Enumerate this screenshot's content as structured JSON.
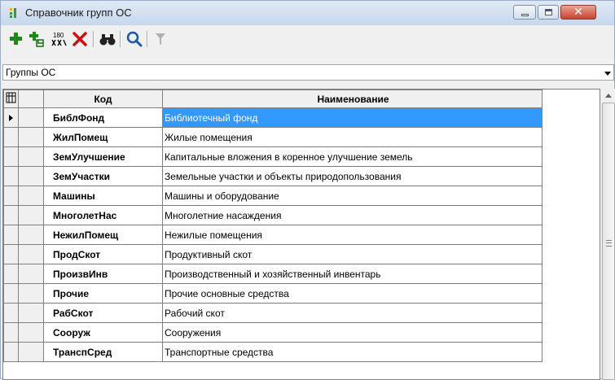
{
  "window": {
    "title": "Справочник групп ОС",
    "close_glyph": "✕"
  },
  "toolbar": {
    "buttons": [
      {
        "icon": "add-icon"
      },
      {
        "icon": "add-child-icon"
      },
      {
        "icon": "numbering-icon",
        "label": "180"
      },
      {
        "icon": "delete-icon"
      },
      {
        "icon": "find-icon"
      },
      {
        "icon": "search-icon"
      },
      {
        "icon": "filter-icon"
      }
    ]
  },
  "group_selector": {
    "value": "Группы ОС"
  },
  "table": {
    "headers": {
      "code": "Код",
      "name": "Наименование"
    },
    "rows": [
      {
        "code": "БиблФонд",
        "name": "Библиотечный фонд",
        "selected": true
      },
      {
        "code": "ЖилПомещ",
        "name": "Жилые помещения"
      },
      {
        "code": "ЗемУлучшение",
        "name": "Капитальные вложения в коренное улучшение земель"
      },
      {
        "code": "ЗемУчастки",
        "name": "Земельные участки и объекты природопользования"
      },
      {
        "code": "Машины",
        "name": "Машины и оборудование"
      },
      {
        "code": "МноголетНас",
        "name": "Многолетние насаждения"
      },
      {
        "code": "НежилПомещ",
        "name": "Нежилые помещения"
      },
      {
        "code": "ПродСкот",
        "name": "Продуктивный скот"
      },
      {
        "code": "ПроизвИнв",
        "name": "Производственный и хозяйственный инвентарь"
      },
      {
        "code": "Прочие",
        "name": "Прочие основные средства"
      },
      {
        "code": "РабСкот",
        "name": "Рабочий скот"
      },
      {
        "code": "Сооруж",
        "name": "Сооружения"
      },
      {
        "code": "ТранспСред",
        "name": "Транспортные средства"
      }
    ]
  },
  "colors": {
    "selection": "#3399ff",
    "titlebar": "#c7d7ec",
    "add_icon": "#1a8a1a",
    "delete_icon": "#d01010"
  }
}
